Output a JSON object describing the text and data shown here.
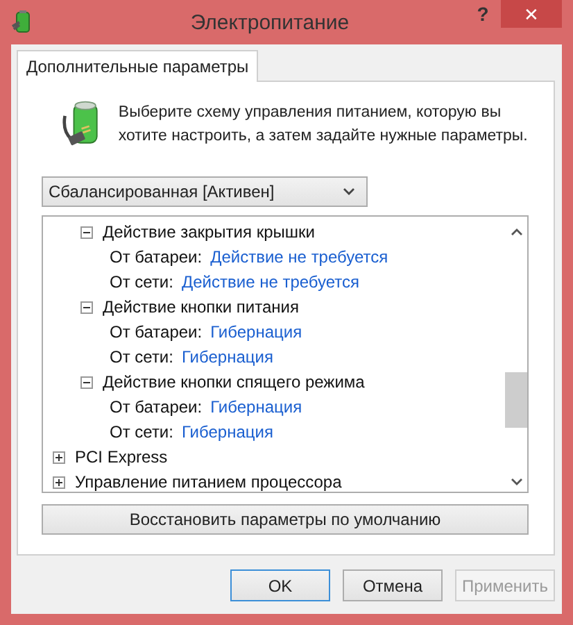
{
  "window": {
    "title": "Электропитание",
    "help": "?",
    "close": "✕"
  },
  "tabs": [
    {
      "label": "Дополнительные параметры",
      "selected": true
    }
  ],
  "intro": "Выберите схему управления питанием, которую вы хотите настроить, а затем задайте нужные параметры.",
  "plan_dropdown": {
    "value": "Сбалансированная [Активен]"
  },
  "tree": {
    "items": [
      {
        "children": [
          {
            "label": "Действие закрытия крышки",
            "expanded": true,
            "children": [
              {
                "label": "От батареи:",
                "value": "Действие не требуется"
              },
              {
                "label": "От сети:",
                "value": "Действие не требуется"
              }
            ]
          },
          {
            "label": "Действие кнопки питания",
            "expanded": true,
            "children": [
              {
                "label": "От батареи:",
                "value": "Гибернация"
              },
              {
                "label": "От сети:",
                "value": "Гибернация"
              }
            ]
          },
          {
            "label": "Действие кнопки спящего режима",
            "expanded": true,
            "children": [
              {
                "label": "От батареи:",
                "value": "Гибернация"
              },
              {
                "label": "От сети:",
                "value": "Гибернация"
              }
            ]
          }
        ]
      },
      {
        "label": "PCI Express",
        "expanded": false
      },
      {
        "label": "Управление питанием процессора",
        "expanded": false
      }
    ]
  },
  "restore_button": "Восстановить параметры по умолчанию",
  "buttons": [
    {
      "label": "OK",
      "kind": "default",
      "disabled": false
    },
    {
      "label": "Отмена",
      "kind": "normal",
      "disabled": false
    },
    {
      "label": "Применить",
      "kind": "normal",
      "disabled": true
    }
  ]
}
